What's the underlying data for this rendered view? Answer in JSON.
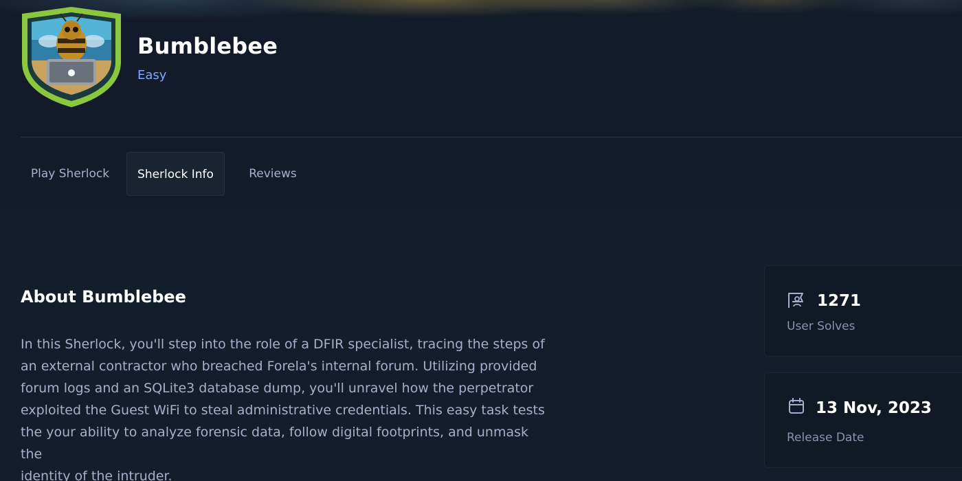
{
  "sherlock": {
    "title": "Bumblebee",
    "difficulty": "Easy",
    "badge_icon": "bumblebee-badge-icon"
  },
  "tabs": [
    {
      "label": "Play Sherlock",
      "active": false
    },
    {
      "label": "Sherlock Info",
      "active": true
    },
    {
      "label": "Reviews",
      "active": false
    }
  ],
  "about": {
    "heading": "About Bumblebee",
    "lines": [
      "In this Sherlock, you'll step into the role of a DFIR specialist, tracing the steps of",
      "an external contractor who breached Forela's internal forum. Utilizing provided",
      "forum logs and an SQLite3 database dump, you'll unravel how the perpetrator",
      "exploited the Guest WiFi to steal administrative credentials. This easy task tests",
      "the your ability to analyze forensic data, follow digital footprints, and unmask the",
      "identity of the intruder."
    ]
  },
  "stats": {
    "solves": {
      "value": "1271",
      "label": "User Solves",
      "icon": "user-flag-icon"
    },
    "release": {
      "value": "13 Nov, 2023",
      "label": "Release Date",
      "icon": "calendar-icon"
    }
  },
  "colors": {
    "background": "#141d2b",
    "header": "#131b2b",
    "difficulty_easy": "#7ea9ff",
    "text_muted": "#a4b1cd",
    "badge_green": "#8ac73e"
  }
}
